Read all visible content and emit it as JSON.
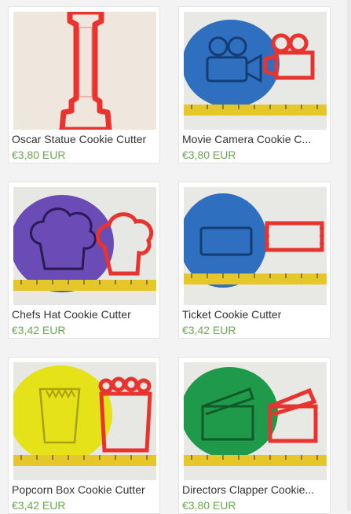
{
  "products": [
    {
      "title": "Oscar Statue Cookie Cutter",
      "price": "€3,80 EUR",
      "icon": "oscar-statue-cookie-cutter-image"
    },
    {
      "title": "Movie Camera Cookie C...",
      "price": "€3,80 EUR",
      "icon": "movie-camera-cookie-cutter-image"
    },
    {
      "title": "Chefs Hat Cookie Cutter",
      "price": "€3,42 EUR",
      "icon": "chefs-hat-cookie-cutter-image"
    },
    {
      "title": "Ticket Cookie Cutter",
      "price": "€3,42 EUR",
      "icon": "ticket-cookie-cutter-image"
    },
    {
      "title": "Popcorn Box Cookie Cutter",
      "price": "€3,42 EUR",
      "icon": "popcorn-box-cookie-cutter-image"
    },
    {
      "title": "Directors Clapper Cookie...",
      "price": "€3,80 EUR",
      "icon": "directors-clapper-cookie-cutter-image"
    }
  ],
  "colors": {
    "price": "#6aa84f",
    "cutter": "#e8332f",
    "blue_dough": "#2f6fc0",
    "purple_dough": "#6b4bb5",
    "yellow_dough": "#e6e21a",
    "green_dough": "#1f9a4a"
  }
}
